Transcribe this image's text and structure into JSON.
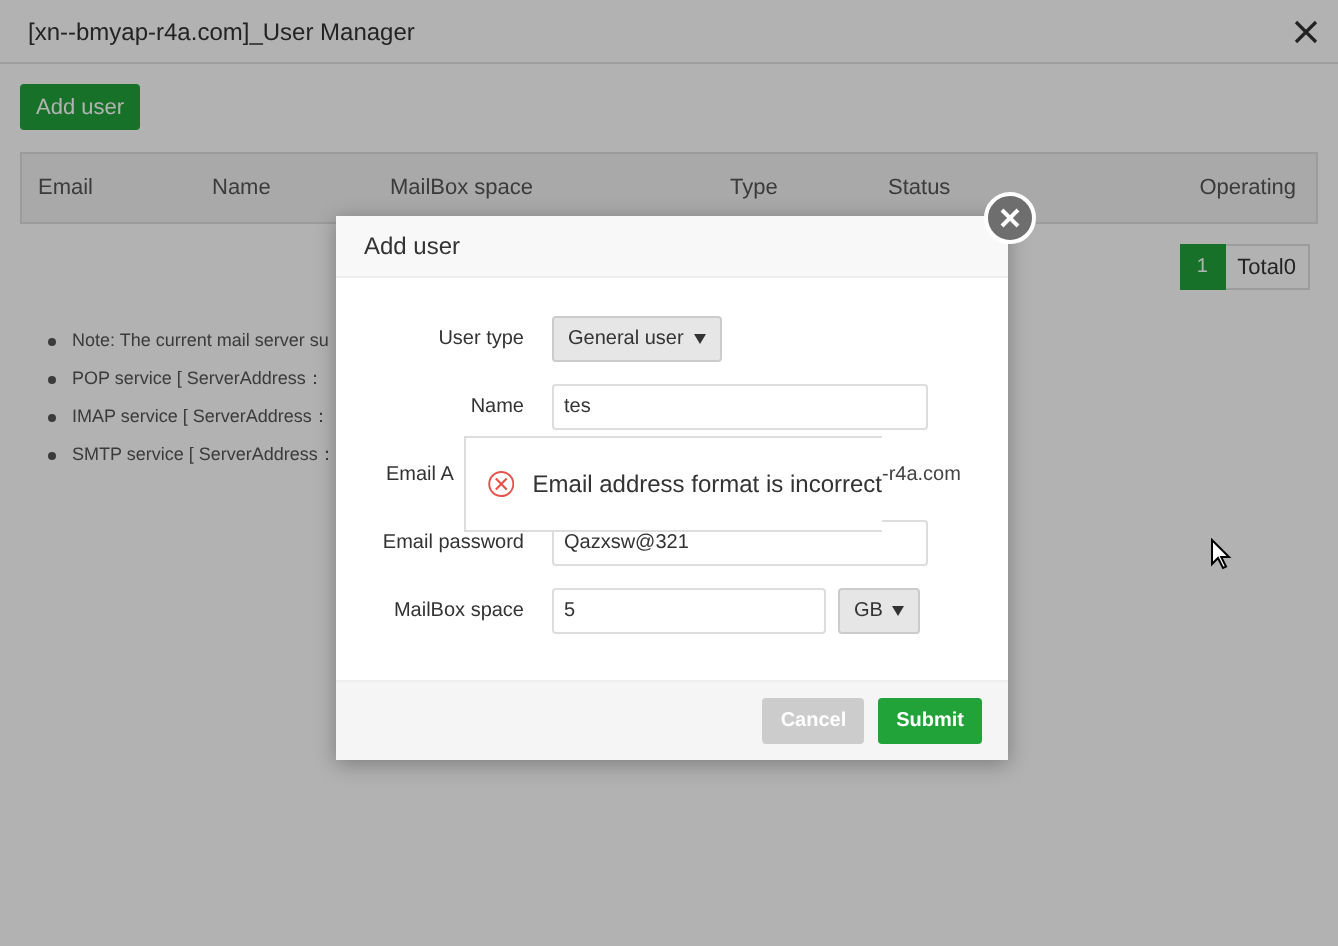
{
  "window": {
    "title": "[xn--bmyap-r4a.com]_User Manager"
  },
  "toolbar": {
    "add_button": "Add user"
  },
  "table": {
    "columns": [
      "Email",
      "Name",
      "MailBox space",
      "Type",
      "Status",
      "Operating"
    ]
  },
  "pagination": {
    "pages": [
      {
        "label": "1",
        "selected": true
      }
    ],
    "total": "Total0"
  },
  "notes": [
    "Note: The current mail server su",
    "POP service [ ServerAddress：",
    "IMAP service [ ServerAddress：",
    "SMTP service [ ServerAddress："
  ],
  "dialog": {
    "title": "Add user",
    "fields": [
      {
        "kind": "select",
        "label": "User type",
        "value": "General user"
      },
      {
        "kind": "input",
        "label": "Name",
        "value": "tes"
      },
      {
        "kind": "suffix",
        "label": "Email A",
        "suffix": "-r4a.com"
      },
      {
        "kind": "input",
        "label": "Email password",
        "value": "Qazxsw@321"
      },
      {
        "kind": "input_unit",
        "label": "MailBox space",
        "value": "5",
        "unit": "GB"
      }
    ],
    "buttons": [
      {
        "label": "Cancel",
        "disabled": true
      },
      {
        "label": "Submit",
        "disabled": false
      }
    ]
  },
  "toast": {
    "message": "Email address format is incorrect"
  }
}
